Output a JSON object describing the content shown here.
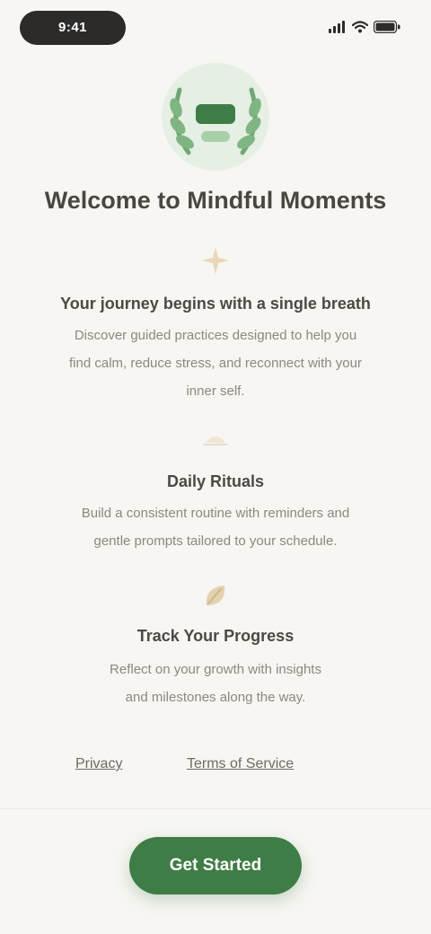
{
  "status_bar": {
    "time": "9:41"
  },
  "headline": "Welcome to Mindful Moments",
  "sections": [
    {
      "title": "Your journey begins with a single breath",
      "body_lines": [
        "Discover guided practices designed to help you",
        "find calm, reduce stress, and reconnect with your",
        "inner self."
      ],
      "icon": "sparkle-icon"
    },
    {
      "title": "Daily Rituals",
      "body_lines": [
        "Build a consistent routine with reminders and",
        "gentle prompts tailored to your schedule."
      ],
      "icon": "sunrise-icon"
    },
    {
      "title": "Track Your Progress",
      "body_lines": [
        "Reflect on your growth with insights",
        "and milestones along the way."
      ],
      "icon": "leaf-icon"
    }
  ],
  "links": {
    "privacy": "Privacy",
    "terms": "Terms of Service"
  },
  "cta": {
    "label": "Get Started"
  },
  "colors": {
    "background": "#f7f6f3",
    "accent": "#3f7d46",
    "accent_light": "#8fbf8f",
    "muted_icon": "#e8d7b9"
  }
}
